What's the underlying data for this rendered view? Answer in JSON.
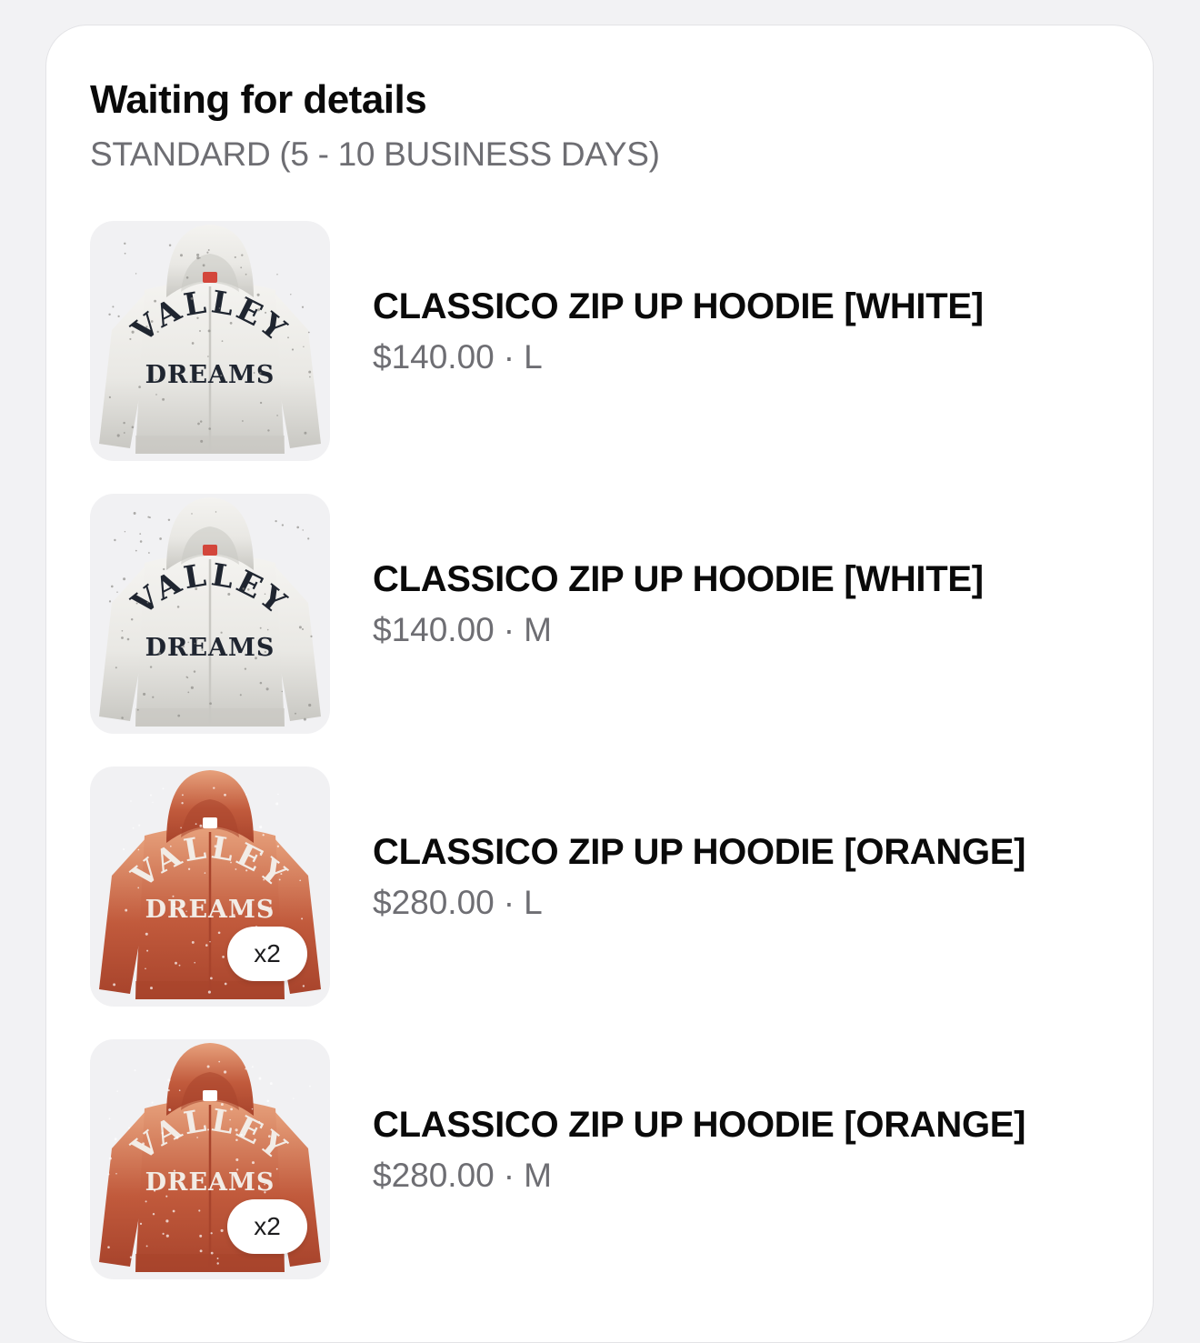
{
  "order": {
    "title": "Waiting for details",
    "shipping_method": "STANDARD (5 - 10 BUSINESS DAYS)"
  },
  "items": [
    {
      "name": "CLASSICO ZIP UP HOODIE [WHITE]",
      "price": "$140.00",
      "separator": "·",
      "size": "L",
      "quantity_badge": "",
      "image": "white-zip-hoodie",
      "shirt_text_top": "VALLEY",
      "shirt_text_bottom": "DREAMS"
    },
    {
      "name": "CLASSICO ZIP UP HOODIE [WHITE]",
      "price": "$140.00",
      "separator": "·",
      "size": "M",
      "quantity_badge": "",
      "image": "white-zip-hoodie",
      "shirt_text_top": "VALLEY",
      "shirt_text_bottom": "DREAMS"
    },
    {
      "name": "CLASSICO ZIP UP HOODIE [ORANGE]",
      "price": "$280.00",
      "separator": "·",
      "size": "L",
      "quantity_badge": "x2",
      "image": "orange-zip-hoodie",
      "shirt_text_top": "VALLEY",
      "shirt_text_bottom": "DREAMS"
    },
    {
      "name": "CLASSICO ZIP UP HOODIE [ORANGE]",
      "price": "$280.00",
      "separator": "·",
      "size": "M",
      "quantity_badge": "x2",
      "image": "orange-zip-hoodie",
      "shirt_text_top": "VALLEY",
      "shirt_text_bottom": "DREAMS"
    }
  ],
  "colors": {
    "background": "#f2f2f4",
    "card": "#ffffff",
    "text_primary": "#0a0a0a",
    "text_secondary": "#6e6e73",
    "thumb_bg": "#f1f1f3",
    "white_hoodie": "#e9e8e4",
    "white_hoodie_shade": "#c9c8c3",
    "white_hoodie_letters": "#1f2530",
    "orange_hoodie": "#c15a3c",
    "orange_hoodie_shade": "#a8442c",
    "orange_hoodie_light": "#e7a17c",
    "orange_hoodie_letters": "#f2ece6"
  }
}
